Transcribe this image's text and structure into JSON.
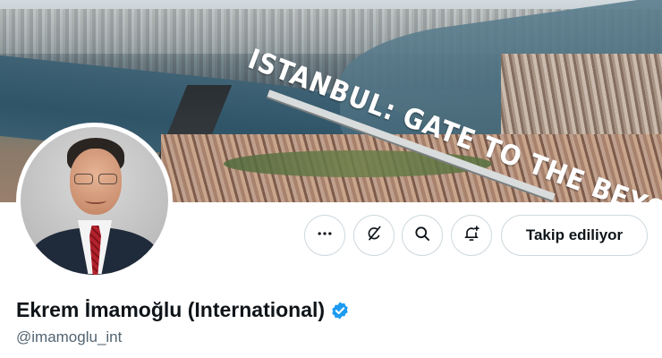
{
  "banner": {
    "slogan": "ISTANBUL: GATE TO THE BEYOND"
  },
  "profile": {
    "display_name": "Ekrem İmamoğlu (International)",
    "handle": "@imamoglu_int",
    "verified_badge": "verified-check-icon"
  },
  "actions": {
    "more_icon": "more-horizontal-icon",
    "grok_icon": "grok-icon",
    "search_icon": "search-icon",
    "notify_icon": "bell-plus-icon",
    "follow_label": "Takip ediliyor"
  },
  "colors": {
    "verified_blue": "#1d9bf0",
    "text_primary": "#0f1419",
    "text_secondary": "#536471",
    "border": "#cfd9de"
  }
}
